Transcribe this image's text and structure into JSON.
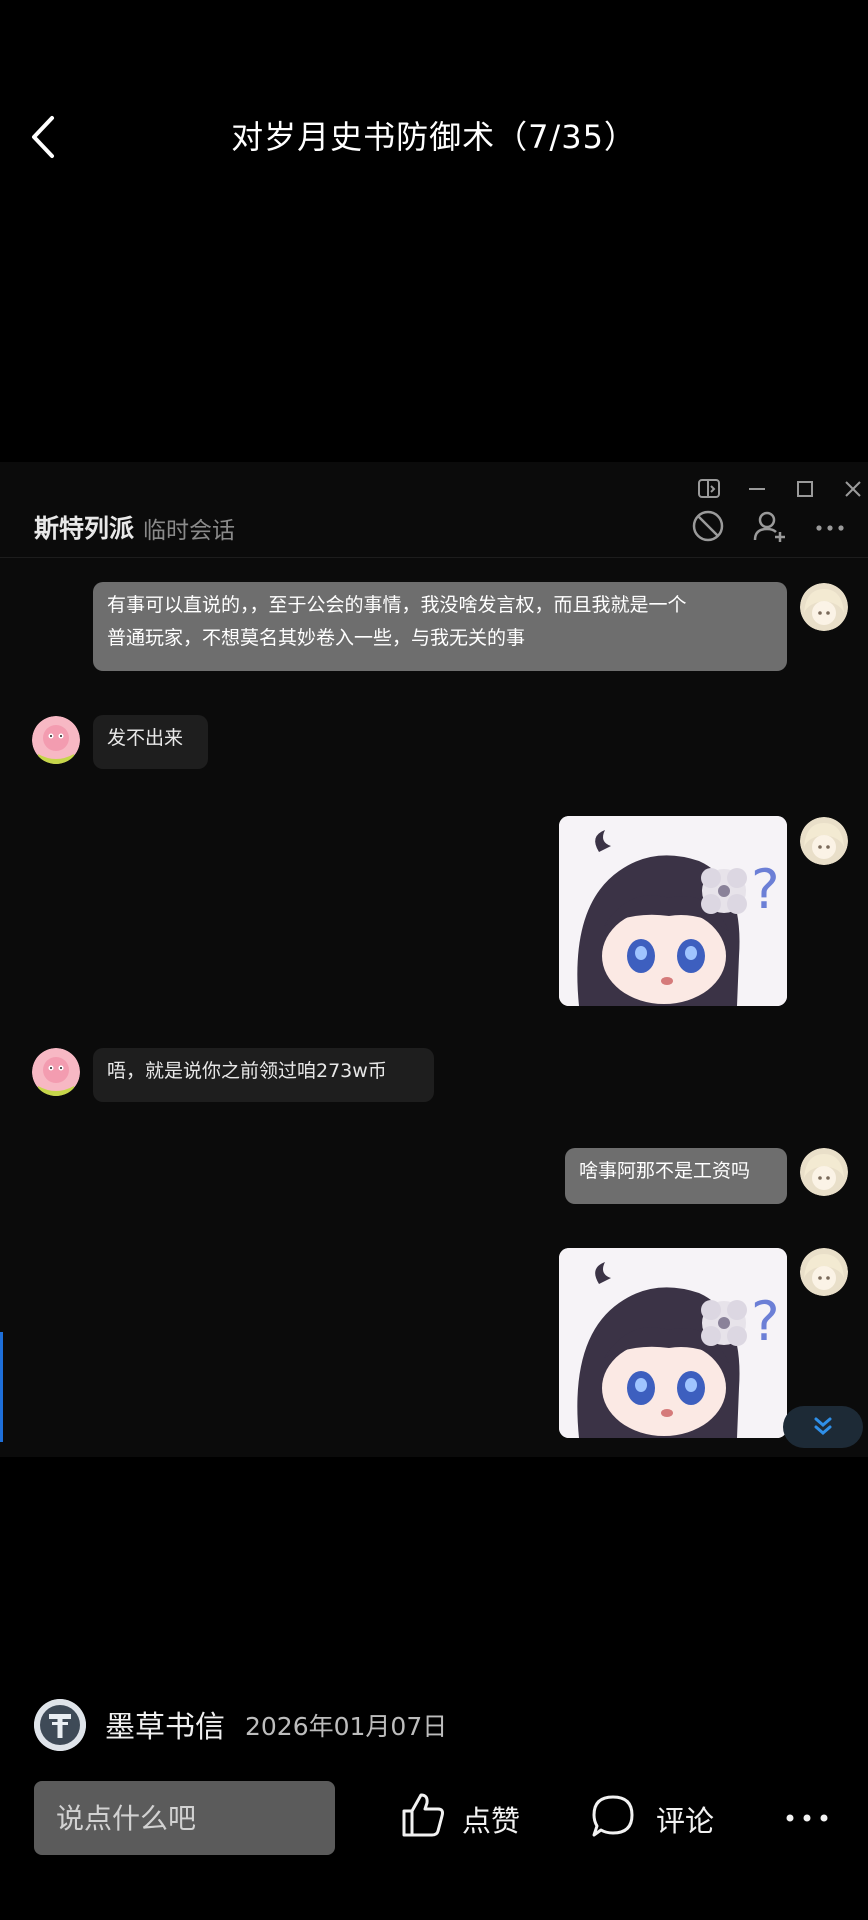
{
  "header": {
    "title": "对岁月史书防御术（7/35）"
  },
  "chat": {
    "contact_name": "斯特列派",
    "contact_subtitle": "临时会话",
    "messages": [
      {
        "from": "me",
        "type": "text",
        "text_line1": "有事可以直说的，，至于公会的事情，我没啥发言权，而且我就是一个",
        "text_line2": "普通玩家，不想莫名其妙卷入一些，与我无关的事"
      },
      {
        "from": "other",
        "type": "text",
        "text": "发不出来"
      },
      {
        "from": "me",
        "type": "sticker",
        "sticker": "confused-anime-girl-sticker"
      },
      {
        "from": "other",
        "type": "text",
        "text": "唔，就是说你之前领过咱273w币"
      },
      {
        "from": "me",
        "type": "text",
        "text": "啥事阿那不是工资吗"
      },
      {
        "from": "me",
        "type": "sticker",
        "sticker": "confused-anime-girl-sticker"
      }
    ]
  },
  "post": {
    "author": "墨草书信",
    "date": "2026年01月07日"
  },
  "actions": {
    "comment_placeholder": "说点什么吧",
    "like_label": "点赞",
    "comment_label": "评论"
  },
  "colors": {
    "background": "#000000",
    "my_bubble": "#6e6e6e",
    "other_bubble": "#1e1e1e",
    "accent_blue": "#1e6fd9"
  }
}
